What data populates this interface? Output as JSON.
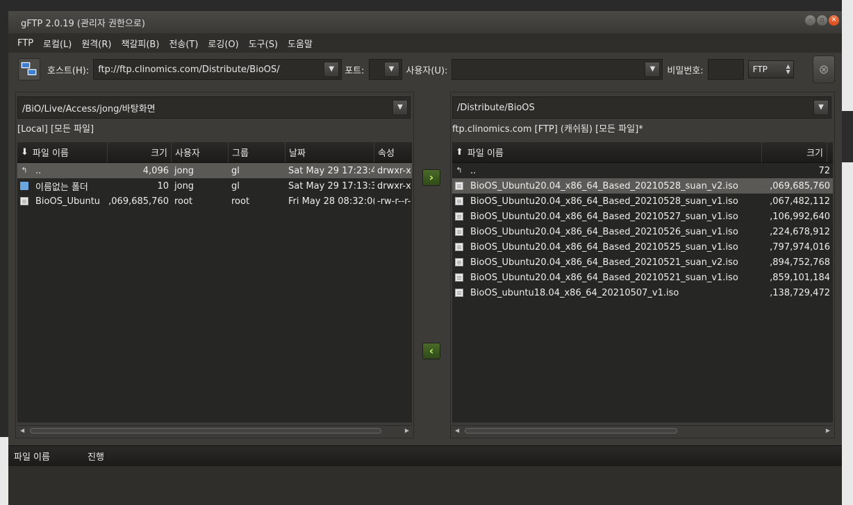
{
  "window": {
    "title": "gFTP 2.0.19 (관리자 권한으로)"
  },
  "menubar": [
    "FTP",
    "로컬(L)",
    "원격(R)",
    "책갈피(B)",
    "전송(T)",
    "로깅(O)",
    "도구(S)",
    "도움말"
  ],
  "toolbar": {
    "host_label": "호스트(H):",
    "host_value": "ftp://ftp.clinomics.com/Distribute/BioOS/",
    "port_label": "포트:",
    "port_value": "",
    "user_label": "사용자(U):",
    "user_value": "",
    "password_label": "비밀번호:",
    "protocol": "FTP"
  },
  "local": {
    "path": "/BiO/Live/Access/jong/바탕화면",
    "status": "[Local] [모든 파일]",
    "columns": [
      "파일 이름",
      "크기",
      "사용자",
      "그룹",
      "날짜",
      "속성"
    ],
    "rows": [
      {
        "icon": "up-dir-icon",
        "name": "..",
        "size": "4,096",
        "user": "jong",
        "group": "gl",
        "date": "Sat May 29 17:23:4",
        "attr": "drwxr-x",
        "selected": true
      },
      {
        "icon": "folder-icon",
        "name": "이름없는 폴더",
        "size": "10",
        "user": "jong",
        "group": "gl",
        "date": "Sat May 29 17:13:3",
        "attr": "drwxr-x",
        "selected": false
      },
      {
        "icon": "file-icon",
        "name": "BioOS_Ubuntu",
        "size": ",069,685,760",
        "user": "root",
        "group": "root",
        "date": "Fri May 28 08:32:0(",
        "attr": "-rw-r--r-",
        "selected": false
      }
    ]
  },
  "remote": {
    "path": "/Distribute/BioOS",
    "status": "ftp.clinomics.com [FTP] (캐쉬됨) [모든 파일]*",
    "columns": [
      "파일 이름",
      "크기"
    ],
    "rows": [
      {
        "icon": "up-dir-icon",
        "name": "..",
        "size": "72",
        "selected": false
      },
      {
        "icon": "file-icon",
        "name": "BioOS_Ubuntu20.04_x86_64_Based_20210528_suan_v2.iso",
        "size": ",069,685,760",
        "selected": true
      },
      {
        "icon": "file-icon",
        "name": "BioOS_Ubuntu20.04_x86_64_Based_20210528_suan_v1.iso",
        "size": ",067,482,112",
        "selected": false
      },
      {
        "icon": "file-icon",
        "name": "BioOS_Ubuntu20.04_x86_64_Based_20210527_suan_v1.iso",
        "size": ",106,992,640",
        "selected": false
      },
      {
        "icon": "file-icon",
        "name": "BioOS_Ubuntu20.04_x86_64_Based_20210526_suan_v1.iso",
        "size": ",224,678,912",
        "selected": false
      },
      {
        "icon": "file-icon",
        "name": "BioOS_Ubuntu20.04_x86_64_Based_20210525_suan_v1.iso",
        "size": ",797,974,016",
        "selected": false
      },
      {
        "icon": "file-icon",
        "name": "BioOS_Ubuntu20.04_x86_64_Based_20210521_suan_v2.iso",
        "size": ",894,752,768",
        "selected": false
      },
      {
        "icon": "file-icon",
        "name": "BioOS_Ubuntu20.04_x86_64_Based_20210521_suan_v1.iso",
        "size": ",859,101,184",
        "selected": false
      },
      {
        "icon": "file-icon",
        "name": "BioOS_ubuntu18.04_x86_64_20210507_v1.iso",
        "size": ",138,729,472",
        "selected": false
      }
    ]
  },
  "transfer": {
    "upload_glyph": "›",
    "download_glyph": "‹"
  },
  "queue": {
    "columns": [
      "파일 이름",
      "진행"
    ]
  }
}
